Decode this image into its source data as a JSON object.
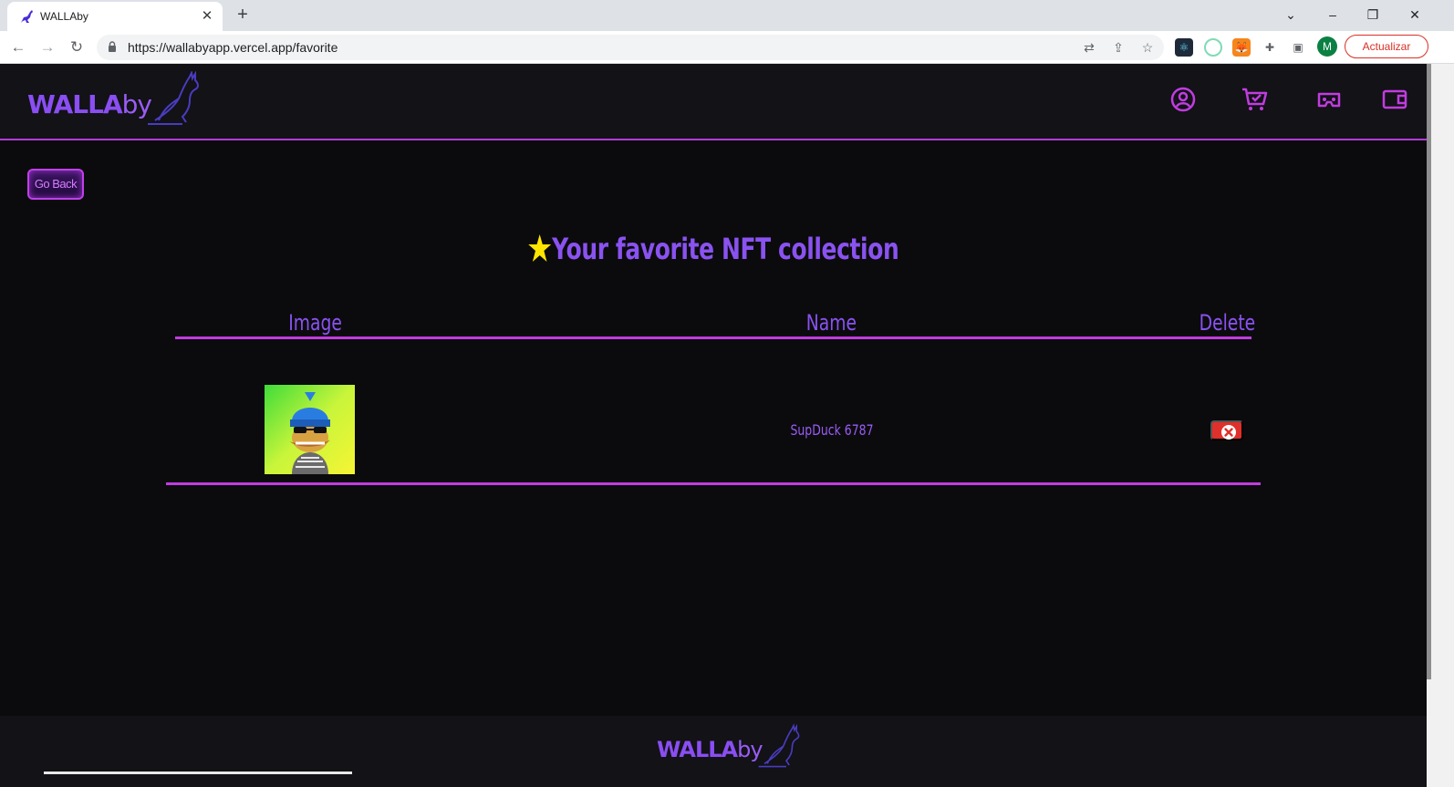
{
  "browser": {
    "tab_title": "WALLAby",
    "url": "https://wallabyapp.vercel.app/favorite",
    "update_label": "Actualizar",
    "profile_initial": "M"
  },
  "header": {
    "logo_main": "WALLA",
    "logo_by": "by",
    "icons": [
      "user-circle-icon",
      "cart-check-icon",
      "vr-headset-icon",
      "wallet-icon"
    ]
  },
  "nav": {
    "go_back_label": "Go Back"
  },
  "favorites": {
    "title": "Your favorite NFT collection",
    "columns": {
      "image": "Image",
      "name": "Name",
      "delete": "Delete"
    },
    "rows": [
      {
        "name": "SupDuck 6787"
      }
    ]
  },
  "colors": {
    "accent_purple": "#8a52f0",
    "border_magenta": "#c23ce0",
    "delete_red": "#e0302b",
    "background": "#0b0b0d"
  }
}
